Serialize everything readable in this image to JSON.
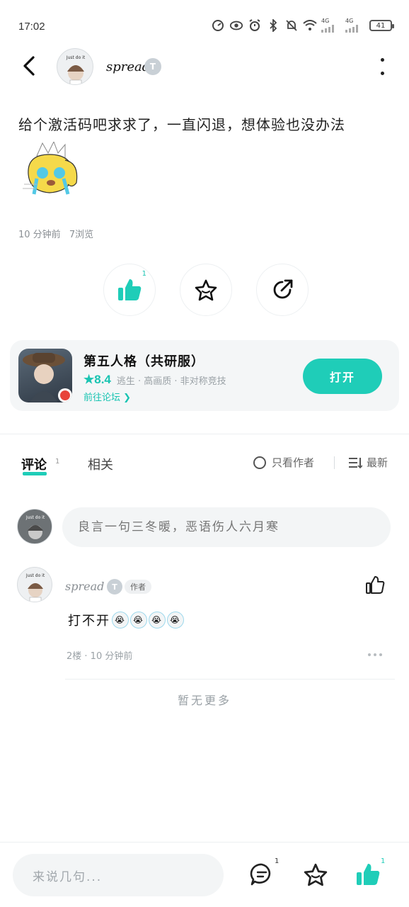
{
  "status_bar": {
    "time": "17:02",
    "network_1": "4G",
    "network_2": "4G",
    "battery": "41"
  },
  "post": {
    "author": "spread",
    "level": "T",
    "text": "给个激活码吧求求了，一直闪退，想体验也没办法",
    "time_ago": "10 分钟前",
    "views": "7浏览",
    "like_count": "1"
  },
  "avatar_caption": "Just do it",
  "game": {
    "title": "第五人格（共研服）",
    "rating": "8.4",
    "tags": "逃生 · 高画质 · 非对称竞技",
    "forum_link": "前往论坛",
    "open_label": "打开"
  },
  "tabs": {
    "comments": "评论",
    "comments_count": "1",
    "related": "相关",
    "author_only": "只看作者",
    "sort": "最新"
  },
  "comment_input": {
    "placeholder": "良言一句三冬暖，恶语伤人六月寒"
  },
  "comments": [
    {
      "author": "spread",
      "level": "T",
      "tag": "作者",
      "text": "打不开",
      "floor_time": "2楼 · 10 分钟前"
    }
  ],
  "no_more": "暂无更多",
  "bottom_bar": {
    "placeholder": "来说几句...",
    "comment_count": "1",
    "like_count": "1"
  },
  "colors": {
    "accent": "#1fcdb8",
    "text": "#222222",
    "muted": "#9aa1a6"
  }
}
